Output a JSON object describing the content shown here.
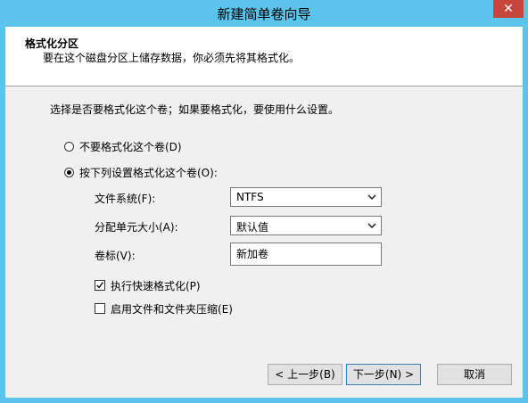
{
  "window": {
    "title": "新建简单卷向导",
    "close_glyph": "✕"
  },
  "header": {
    "title": "格式化分区",
    "description": "要在这个磁盘分区上储存数据，你必须先将其格式化。"
  },
  "body": {
    "prompt": "选择是否要格式化这个卷；如果要格式化，要使用什么设置。",
    "options": [
      {
        "label": "不要格式化这个卷(D)",
        "selected": false
      },
      {
        "label": "按下列设置格式化这个卷(O):",
        "selected": true
      }
    ],
    "file_system": {
      "label": "文件系统(F):",
      "value": "NTFS"
    },
    "allocation_unit": {
      "label": "分配单元大小(A):",
      "value": "默认值"
    },
    "volume_label": {
      "label": "卷标(V):",
      "value": "新加卷"
    },
    "quick_format": {
      "label": "执行快速格式化(P)",
      "checked": true
    },
    "compression": {
      "label": "启用文件和文件夹压缩(E)",
      "checked": false
    }
  },
  "buttons": {
    "back": "< 上一步(B)",
    "next": "下一步(N) >",
    "cancel": "取消"
  }
}
